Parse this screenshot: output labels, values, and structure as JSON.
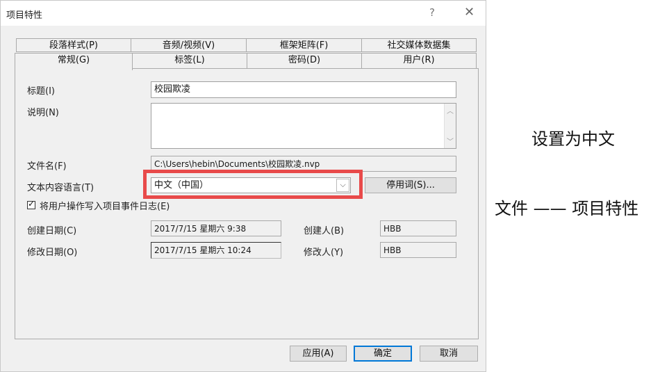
{
  "window": {
    "title": "项目特性",
    "help_glyph": "?",
    "close_glyph": "✕"
  },
  "tabs_back": [
    {
      "label": "段落样式(P)"
    },
    {
      "label": "音频/视频(V)"
    },
    {
      "label": "框架矩阵(F)"
    },
    {
      "label": "社交媒体数据集"
    }
  ],
  "tabs_front": [
    {
      "label": "常规(G)",
      "active": true
    },
    {
      "label": "标签(L)"
    },
    {
      "label": "密码(D)"
    },
    {
      "label": "用户(R)"
    }
  ],
  "form": {
    "title_label": "标题(I)",
    "title_value": "校园欺凌",
    "description_label": "说明(N)",
    "description_value": "",
    "filename_label": "文件名(F)",
    "filename_value": "C:\\Users\\hebin\\Documents\\校园欺凌.nvp",
    "language_label": "文本内容语言(T)",
    "language_value": "中文（中国）",
    "stopwords_button": "停用词(S)...",
    "log_checkbox_label": "将用户操作写入项目事件日志(E)",
    "log_checked": true,
    "created_date_label": "创建日期(C)",
    "created_date_value": "2017/7/15 星期六 9:38",
    "created_by_label": "创建人(B)",
    "created_by_value": "HBB",
    "modified_date_label": "修改日期(O)",
    "modified_date_value": "2017/7/15 星期六 10:24",
    "modified_by_label": "修改人(Y)",
    "modified_by_value": "HBB"
  },
  "buttons": {
    "apply": "应用(A)",
    "ok": "确定",
    "cancel": "取消"
  },
  "annotations": {
    "set_chinese": "设置为中文",
    "menu_path": "文件 —— 项目特性"
  },
  "colors": {
    "highlight": "#e84a4a",
    "default_button_border": "#0078d7"
  }
}
